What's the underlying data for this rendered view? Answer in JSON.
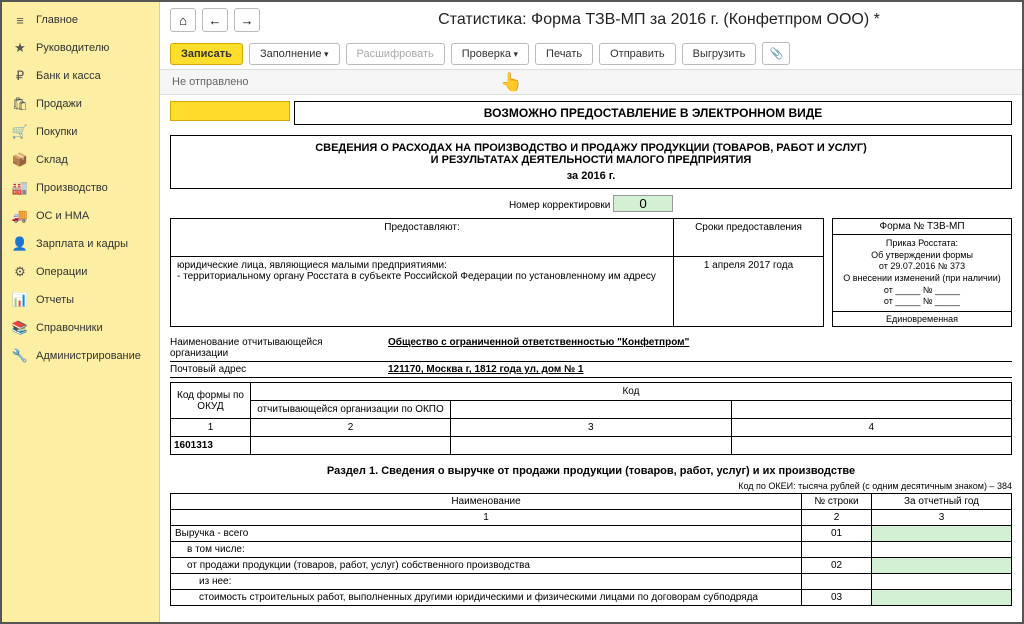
{
  "sidebar": {
    "items": [
      {
        "icon": "≡",
        "label": "Главное"
      },
      {
        "icon": "★",
        "label": "Руководителю"
      },
      {
        "icon": "₽",
        "label": "Банк и касса"
      },
      {
        "icon": "🛍",
        "label": "Продажи"
      },
      {
        "icon": "🛒",
        "label": "Покупки"
      },
      {
        "icon": "📦",
        "label": "Склад"
      },
      {
        "icon": "🏭",
        "label": "Производство"
      },
      {
        "icon": "🚚",
        "label": "ОС и НМА"
      },
      {
        "icon": "👤",
        "label": "Зарплата и кадры"
      },
      {
        "icon": "⚙",
        "label": "Операции"
      },
      {
        "icon": "📊",
        "label": "Отчеты"
      },
      {
        "icon": "📚",
        "label": "Справочники"
      },
      {
        "icon": "🔧",
        "label": "Администрирование"
      }
    ]
  },
  "header": {
    "title": "Статистика: Форма ТЗВ-МП за 2016 г. (Конфетпром ООО) *"
  },
  "toolbar": {
    "write": "Записать",
    "fill": "Заполнение",
    "decode": "Расшифровать",
    "check": "Проверка",
    "print": "Печать",
    "send": "Отправить",
    "upload": "Выгрузить",
    "attach": "📎"
  },
  "status": "Не отправлено",
  "form": {
    "banner_electronic": "ВОЗМОЖНО ПРЕДОСТАВЛЕНИЕ В ЭЛЕКТРОННОМ ВИДЕ",
    "banner_title1": "СВЕДЕНИЯ О РАСХОДАХ НА ПРОИЗВОДСТВО И ПРОДАЖУ ПРОДУКЦИИ (ТОВАРОВ, РАБОТ И УСЛУГ)",
    "banner_title2": "И РЕЗУЛЬТАТАХ ДЕЯТЕЛЬНОСТИ МАЛОГО ПРЕДПРИЯТИЯ",
    "banner_year": "за 2016 г.",
    "correction_label": "Номер корректировки",
    "correction_value": "0",
    "provide_hdr": "Предоставляют:",
    "deadline_hdr": "Сроки предоставления",
    "provide_text": "юридические лица, являющиеся малыми предприятиями:\n- территориальному органу Росстата в субъекте Российской Федерации по установленному им адресу",
    "deadline_text": "1 апреля 2017 года",
    "form_no": "Форма № ТЗВ-МП",
    "rosstat": "Приказ Росстата:",
    "approval": "Об утверждении формы",
    "approval_date": "от 29.07.2016 № 373",
    "changes": "О внесении изменений (при наличии)",
    "from1": "от _____ № _____",
    "from2": "от _____ № _____",
    "onetime": "Единовременная",
    "org_name_label": "Наименование отчитывающейся организации",
    "org_name": "Общество с ограниченной ответственностью \"Конфетпром\"",
    "addr_label": "Почтовый адрес",
    "addr": "121170, Москва г, 1812 года ул, дом № 1",
    "code_hdr": "Код",
    "okud_label": "Код формы по ОКУД",
    "okpo_label": "отчитывающейся организации по ОКПО",
    "col1": "1",
    "col2": "2",
    "col3": "3",
    "col4": "4",
    "okud": "1601313",
    "section1": "Раздел 1. Сведения о выручке от продажи продукции (товаров, работ, услуг) и их производстве",
    "okei": "Код по ОКЕИ: тысяча рублей (с одним десятичным знаком) – 384",
    "tbl_name": "Наименование",
    "tbl_row": "№ строки",
    "tbl_year": "За отчетный год",
    "rows": [
      {
        "name": "Выручка - всего",
        "num": "01",
        "indent": 0
      },
      {
        "name": "в том числе:",
        "num": "",
        "indent": 1
      },
      {
        "name": "от продажи продукции (товаров, работ, услуг) собственного производства",
        "num": "02",
        "indent": 1
      },
      {
        "name": "из нее:",
        "num": "",
        "indent": 2
      },
      {
        "name": "стоимость строительных работ, выполненных другими юридическими и физическими лицами по договорам субподряда",
        "num": "03",
        "indent": 2
      }
    ]
  }
}
